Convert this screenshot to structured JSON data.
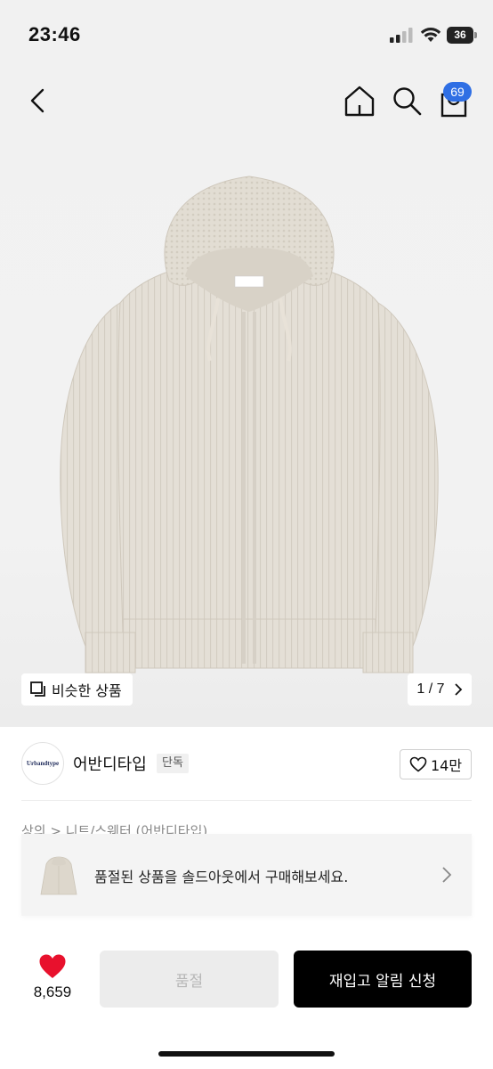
{
  "status_bar": {
    "time": "23:46",
    "battery": "36"
  },
  "nav": {
    "cart_count": "69"
  },
  "gallery": {
    "similar_label": "비슷한 상품",
    "counter": "1 / 7"
  },
  "brand": {
    "logo_text": "Urbandtype",
    "name": "어반디타입",
    "tag": "단독",
    "likes": "14만"
  },
  "breadcrumb": "상의 > 니트/스웨터 (어반디타입)",
  "soldout_banner": {
    "text": "품절된 상품을 솔드아웃에서 구매해보세요."
  },
  "bottom": {
    "wish_count": "8,659",
    "soldout_label": "품절",
    "restock_label": "재입고 알림 신청"
  },
  "colors": {
    "accent_badge": "#2f6fe4",
    "heart": "#e8112d",
    "primary_button": "#000000"
  }
}
